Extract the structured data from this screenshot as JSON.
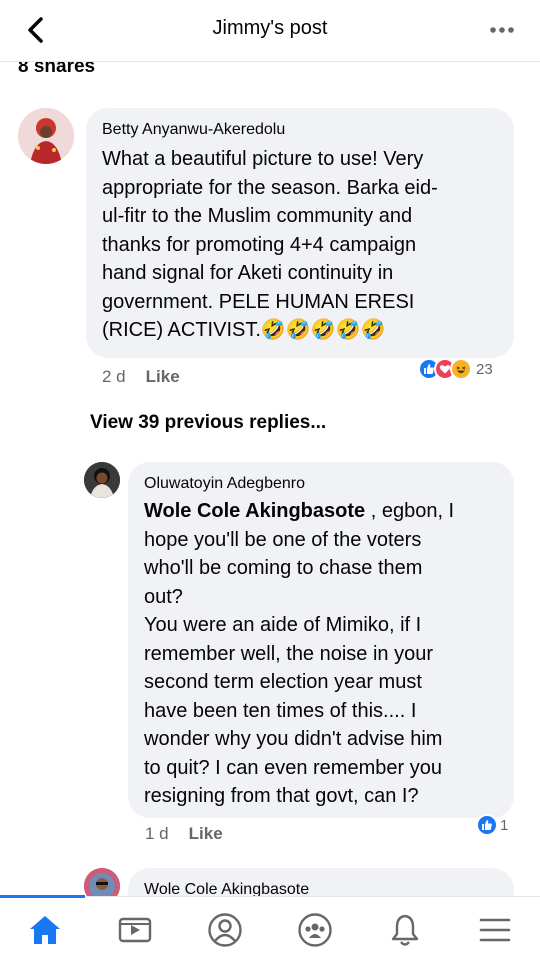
{
  "header": {
    "title": "Jimmy's post",
    "back_icon": "chevron-left-icon",
    "more_icon": "more-horizontal-icon"
  },
  "shares_text": "8 shares",
  "comment1": {
    "author": "Betty Anyanwu-Akeredolu",
    "text_lines": [
      "What a beautiful picture to use! Very",
      "appropriate for the season. Barka eid-",
      "ul-fitr to the Muslim community and",
      "thanks for promoting 4+4 campaign",
      "hand signal for Aketi continuity in",
      "government. PELE HUMAN ERESI",
      "(RICE) ACTIVIST.🤣🤣🤣🤣🤣"
    ],
    "time": "2 d",
    "like_label": "Like",
    "reaction_count": "23"
  },
  "view_previous": "View 39 previous replies...",
  "reply1": {
    "author": "Oluwatoyin Adegbenro",
    "mention": "Wole Cole Akingbasote",
    "first_line_rest": " , egbon, I",
    "text_lines": [
      "hope you'll be one of the voters",
      "who'll be coming to chase them",
      "out?",
      "You were an aide of Mimiko, if I",
      "remember well, the noise in your",
      "second term election year must",
      "have been ten times of this.... I",
      "wonder why you didn't advise him",
      "to quit? I can even remember you",
      "resigning from that govt, can I?"
    ],
    "time": "1 d",
    "like_label": "Like",
    "reaction_count": "1"
  },
  "reply2": {
    "author": "Wole Cole Akingbasote"
  },
  "tabbar": {
    "items": [
      "home-icon",
      "video-icon",
      "profile-icon",
      "groups-icon",
      "notifications-icon",
      "menu-icon"
    ],
    "accent": "#1877f2"
  }
}
